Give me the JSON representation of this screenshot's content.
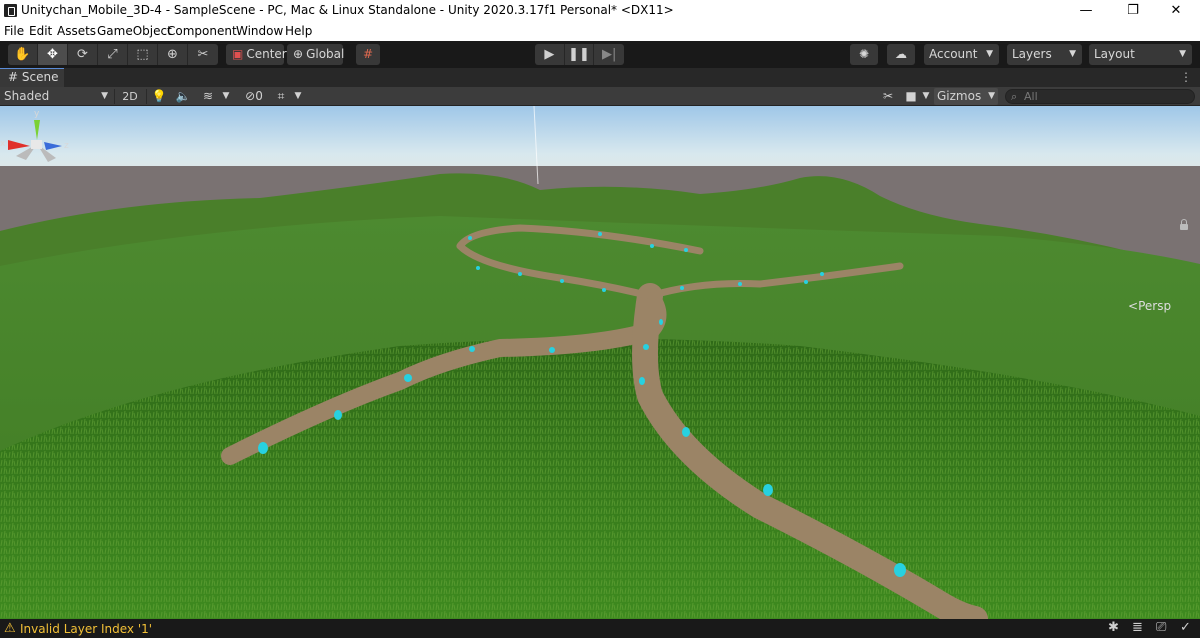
{
  "window": {
    "title": "Unitychan_Mobile_3D-4 - SampleScene - PC, Mac & Linux Standalone - Unity 2020.3.17f1 Personal* <DX11>",
    "minimize": "—",
    "maximize": "❐",
    "close": "✕"
  },
  "menu": [
    "File",
    "Edit",
    "Assets",
    "GameObject",
    "Component",
    "Window",
    "Help"
  ],
  "toolbar": {
    "tools": [
      "hand-tool",
      "move-tool",
      "rotate-tool",
      "scale-tool",
      "rect-tool",
      "transform-tool",
      "custom-tool"
    ],
    "pivot_mode": "Center",
    "pivot_rotation": "Global",
    "account": "Account",
    "layers": "Layers",
    "layout": "Layout"
  },
  "scene_tab": {
    "label": "Scene",
    "shading_mode": "Shaded",
    "mode_2d": "2D",
    "hidden_count": "0",
    "gizmos": "Gizmos",
    "search_placeholder": "All"
  },
  "viewport": {
    "camera_mode": "Persp",
    "axis_y": "y",
    "axis_x": "x",
    "axis_z": "z",
    "colors": {
      "sky_top": "#9fc7e8",
      "horizon": "#7a7272",
      "grass": "#4f8a2c",
      "path": "#9b8466",
      "marker": "#27d1e0"
    }
  },
  "status": {
    "message": "Invalid Layer Index '1'",
    "level": "warning"
  }
}
